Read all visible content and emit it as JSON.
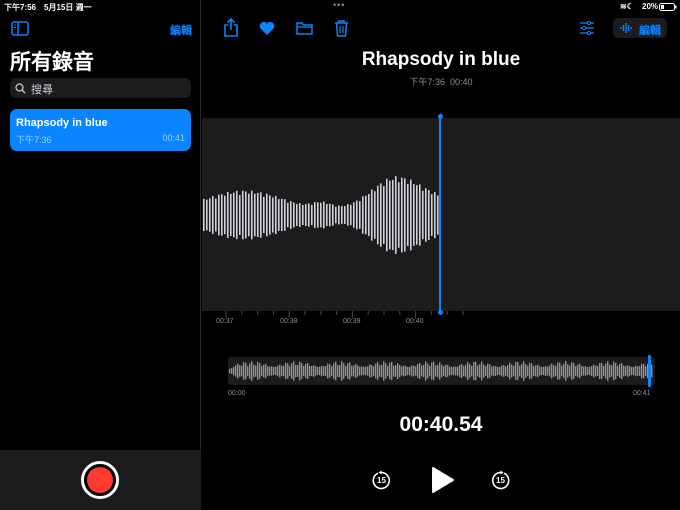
{
  "status": {
    "time": "下午7:56",
    "date": "5月15日 週一",
    "battery": "20%"
  },
  "sidebar": {
    "edit": "編輯",
    "title": "所有錄音",
    "search_placeholder": "搜尋",
    "recordings": [
      {
        "title": "Rhapsody in blue",
        "time": "下午7:36",
        "duration": "00:41"
      }
    ]
  },
  "main": {
    "edit": "編輯",
    "title": "Rhapsody in blue",
    "subtitle_time": "下午7:36",
    "subtitle_duration": "00:40",
    "ticks": [
      "00:37",
      "00:38",
      "00:39",
      "00:40"
    ],
    "overview_start": "00:00",
    "overview_end": "00:41",
    "timer": "00:40.54",
    "skip_back": "15",
    "skip_forward": "15",
    "playback_fraction": 0.989
  },
  "colors": {
    "accent": "#0a84ff",
    "record": "#ff3b30"
  }
}
